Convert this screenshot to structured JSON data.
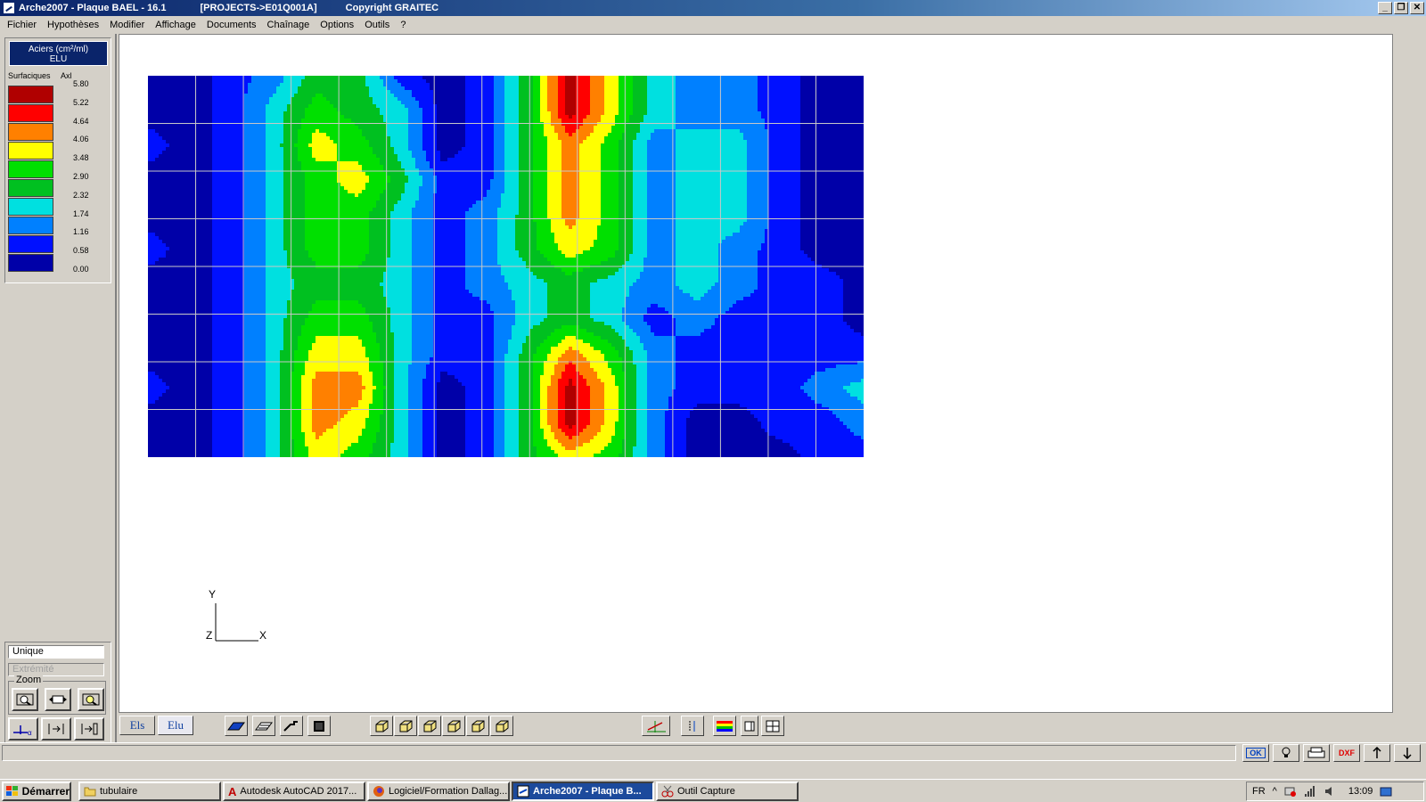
{
  "window": {
    "title": "Arche2007 - Plaque BAEL - 16.1",
    "project": "[PROJECTS->E01Q001A]",
    "copyright": "Copyright GRAITEC"
  },
  "menu": [
    "Fichier",
    "Hypothèses",
    "Modifier",
    "Affichage",
    "Documents",
    "Chaînage",
    "Options",
    "Outils",
    "?"
  ],
  "legend": {
    "title_line1": "Aciers (cm²/ml)",
    "title_line2": "ELU",
    "label_left": "Surfaciques",
    "label_right": "Axl",
    "values": [
      "5.80",
      "5.22",
      "4.64",
      "4.06",
      "3.48",
      "2.90",
      "2.32",
      "1.74",
      "1.16",
      "0.58",
      "0.00"
    ],
    "colors": [
      "#b00000",
      "#ff0000",
      "#ff8000",
      "#ffff00",
      "#00e000",
      "#00c020",
      "#00e0e0",
      "#0080ff",
      "#0010ff",
      "#0000a8"
    ]
  },
  "selection": {
    "mode": "Unique",
    "mode2": "Extrémité",
    "zoom_label": "Zoom"
  },
  "axes": {
    "y": "Y",
    "z": "Z",
    "x": "X"
  },
  "bottom_toolbar": {
    "els": "Els",
    "elu": "Elu"
  },
  "status_icons": {
    "ok": "OK",
    "dxf": "DXF"
  },
  "taskbar": {
    "start": "Démarrer",
    "items": [
      "tubulaire",
      "Autodesk AutoCAD 2017...",
      "Logiciel/Formation Dallag...",
      "Arche2007 - Plaque B...",
      "Outil Capture"
    ],
    "language": "FR",
    "clock": "13:09"
  },
  "heatmap": {
    "columns": 15,
    "rows": 8,
    "grid": [
      [
        0,
        0,
        1,
        2,
        4,
        4,
        1,
        0,
        1,
        4,
        9,
        6,
        3,
        2,
        2,
        1,
        0,
        0
      ],
      [
        0,
        0,
        1,
        3,
        5,
        4,
        3,
        0,
        1,
        4,
        9,
        6,
        3,
        2,
        2,
        1,
        0,
        0
      ],
      [
        1,
        0,
        1,
        3,
        6,
        5,
        3,
        0,
        1,
        4,
        7,
        5,
        2,
        3,
        3,
        1,
        0,
        0
      ],
      [
        0,
        0,
        1,
        3,
        5,
        6,
        4,
        1,
        1,
        4,
        7,
        5,
        2,
        3,
        3,
        1,
        0,
        0
      ],
      [
        0,
        0,
        1,
        3,
        5,
        5,
        3,
        1,
        2,
        4,
        7,
        5,
        2,
        3,
        3,
        1,
        0,
        0
      ],
      [
        1,
        0,
        1,
        3,
        5,
        5,
        3,
        1,
        2,
        4,
        6,
        5,
        2,
        3,
        2,
        1,
        0,
        0
      ],
      [
        0,
        0,
        1,
        3,
        4,
        4,
        3,
        1,
        2,
        3,
        4,
        3,
        2,
        3,
        2,
        1,
        1,
        0
      ],
      [
        0,
        0,
        1,
        3,
        5,
        5,
        3,
        1,
        1,
        3,
        4,
        3,
        1,
        2,
        1,
        1,
        1,
        0
      ],
      [
        0,
        0,
        1,
        3,
        6,
        6,
        3,
        1,
        1,
        4,
        7,
        5,
        2,
        1,
        1,
        1,
        1,
        1
      ],
      [
        1,
        0,
        1,
        3,
        7,
        7,
        3,
        0,
        1,
        4,
        9,
        6,
        2,
        1,
        1,
        1,
        2,
        3
      ],
      [
        0,
        0,
        1,
        3,
        7,
        6,
        3,
        0,
        1,
        4,
        9,
        6,
        2,
        0,
        0,
        1,
        1,
        2
      ],
      [
        0,
        0,
        1,
        3,
        6,
        5,
        3,
        0,
        1,
        4,
        6,
        5,
        2,
        0,
        0,
        0,
        1,
        1
      ]
    ]
  }
}
